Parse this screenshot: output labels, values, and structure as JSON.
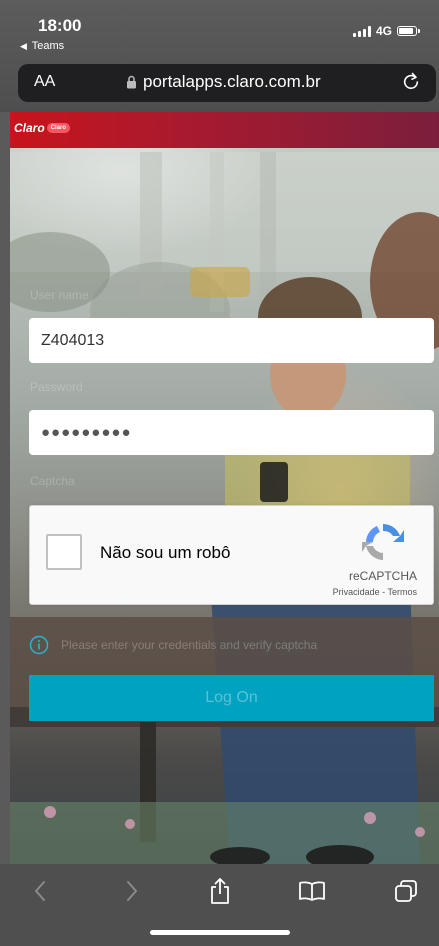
{
  "status_bar": {
    "time": "18:00",
    "back_app": "Teams",
    "network": "4G"
  },
  "browser": {
    "text_size_button": "AA",
    "url": "portalapps.claro.com.br"
  },
  "site": {
    "logo_text": "Claro",
    "logo_pill": "Claro"
  },
  "login_form": {
    "username_label": "User name",
    "username_value": "Z404013",
    "password_label": "Password",
    "password_dots": "●●●●●●●●●",
    "captcha_label": "Captcha"
  },
  "recaptcha": {
    "label": "Não sou um robô",
    "brand": "reCAPTCHA",
    "links": "Privacidade - Termos"
  },
  "info": {
    "message": "Please enter your credentials and verify captcha"
  },
  "logon_button": {
    "label": "Log On"
  },
  "colors": {
    "claro_red": "#c8141c",
    "logon_button": "#00a2c1",
    "recaptcha_blue": "#4a90e2"
  }
}
